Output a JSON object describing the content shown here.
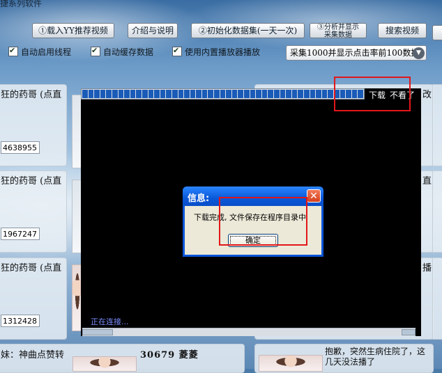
{
  "app": {
    "title": "捷系列软件"
  },
  "toolbar": {
    "load_recommended": "①载入YY推荐视频",
    "intro": "介绍与说明",
    "init_dataset": "②初始化数据集(一天一次)",
    "analyze_line1": "③分析并显示",
    "analyze_line2": "采集数据",
    "search_video": "搜索视频"
  },
  "options": {
    "auto_thread": "自动启用线程",
    "auto_cache": "自动缓存数据",
    "builtin_player": "使用内置播放器播放",
    "collect_select": "采集1000并显示点击率前100数据"
  },
  "cards": [
    {
      "title": "狂的药哥 (点直",
      "id": "4638955"
    },
    {
      "title": "狂的药哥 (点直",
      "id": "1967247"
    },
    {
      "title": "狂的药哥 (点直",
      "id": "1312428"
    },
    {
      "title": "妹：神曲点赞转",
      "id": ""
    }
  ],
  "right_cards": [
    {
      "edge_text": "改"
    },
    {
      "edge_text": "直"
    },
    {
      "edge_text": "播"
    }
  ],
  "bottom_cards": {
    "middle_title": "30679 菱菱",
    "right_title_line1": "抱歉，突然生病住院了，这",
    "right_title_line2": "几天没法播了"
  },
  "player": {
    "download_label": "下载",
    "dismiss_label": "不看了",
    "status": "正在连接...",
    "progress_segments": 47
  },
  "dialog": {
    "title": "信息:",
    "message": "下载完成, 文件保存在程序目录中",
    "ok_label": "确定"
  },
  "colors": {
    "annotation_red": "#e2161a",
    "dialog_blue": "#0c55d8",
    "progress_blue": "#1a5bb8"
  }
}
